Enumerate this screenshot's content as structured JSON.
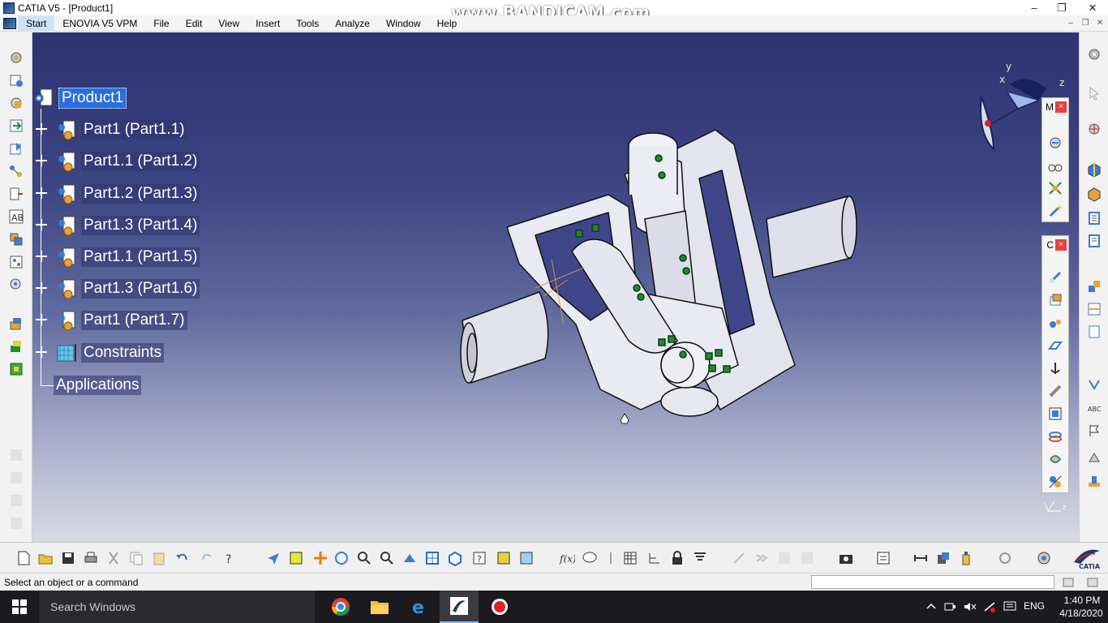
{
  "window": {
    "title": "CATIA V5 - [Product1]",
    "watermark": "www.BANDICAM.com"
  },
  "menu": {
    "items": [
      "Start",
      "ENOVIA V5 VPM",
      "File",
      "Edit",
      "View",
      "Insert",
      "Tools",
      "Analyze",
      "Window",
      "Help"
    ]
  },
  "tree": {
    "root": "Product1",
    "children": [
      "Part1 (Part1.1)",
      "Part1.1 (Part1.2)",
      "Part1.2 (Part1.3)",
      "Part1.3 (Part1.4)",
      "Part1.1 (Part1.5)",
      "Part1.3 (Part1.6)",
      "Part1 (Part1.7)",
      "Constraints",
      "Applications"
    ]
  },
  "compass": {
    "x_label": "x",
    "y_label": "y",
    "z_label": "z"
  },
  "floating_toolbars": {
    "top_title_fragment": "M",
    "second_title_fragment": "C",
    "close_label": "×"
  },
  "status": {
    "message": "Select an object or a command",
    "command_value": ""
  },
  "taskbar": {
    "search_placeholder": "Search Windows",
    "language": "ENG",
    "time": "1:40 PM",
    "date": "4/18/2020"
  },
  "colors": {
    "selection": "#2a6fdb",
    "viewport_top": "#2e3372",
    "viewport_bottom": "#d9dae6",
    "part_fill": "#e9e9f1",
    "constraint_green": "#1f8a2a"
  }
}
